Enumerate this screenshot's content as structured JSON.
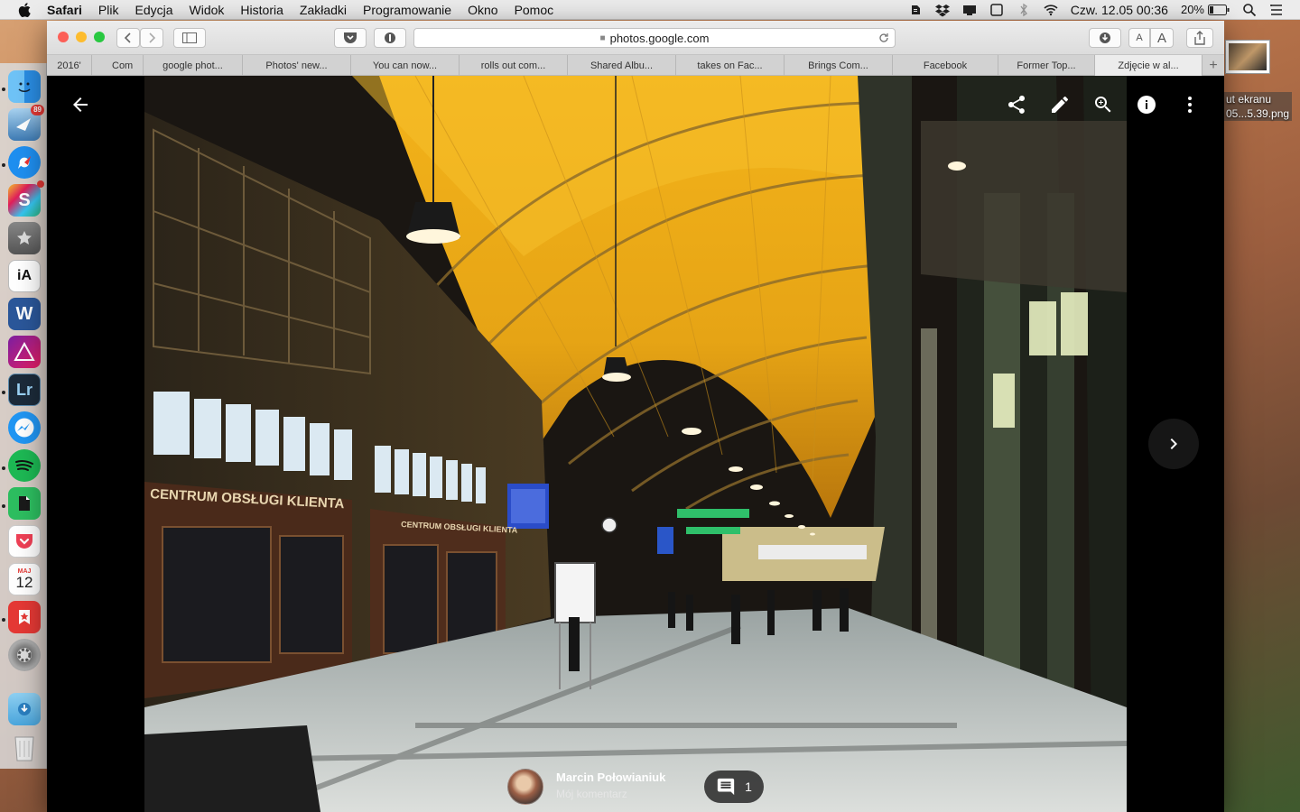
{
  "menubar": {
    "app_name": "Safari",
    "menus": [
      "Plik",
      "Edycja",
      "Widok",
      "Historia",
      "Zakładki",
      "Programowanie",
      "Okno",
      "Pomoc"
    ],
    "clock": "Czw. 12.05  00:36",
    "battery": "20%"
  },
  "browser": {
    "url": "photos.google.com",
    "tabs": [
      {
        "label": "2016'",
        "active": false
      },
      {
        "label": "Com",
        "active": false
      },
      {
        "label": "google phot...",
        "active": false
      },
      {
        "label": "Photos' new...",
        "active": false
      },
      {
        "label": "You can now...",
        "active": false
      },
      {
        "label": "rolls out com...",
        "active": false
      },
      {
        "label": "Shared Albu...",
        "active": false
      },
      {
        "label": "takes on Fac...",
        "active": false
      },
      {
        "label": "Brings Com...",
        "active": false
      },
      {
        "label": "Facebook",
        "active": false
      },
      {
        "label": "Former Top...",
        "active": false
      },
      {
        "label": "Zdjęcie w al...",
        "active": true
      }
    ],
    "text_size_small": "A",
    "text_size_large": "A"
  },
  "viewer": {
    "author": "Marcin Połowianiuk",
    "comment": "Mój komentarz",
    "comment_count": "1",
    "signage_left": "CENTRUM OBSŁUGI KLIENTA",
    "signage_mid": "CENTRUM OBSŁUGI KLIENTA"
  },
  "dock": {
    "badge_mail": "89",
    "calendar_month": "MAJ",
    "calendar_day": "12",
    "word_letter": "W",
    "lr_letters": "Lr",
    "ia_letters": "iA",
    "s_letter": "S"
  },
  "desktop": {
    "file_name_line1": "ut ekranu",
    "file_name_line2": "05...5.39.png"
  },
  "colors": {
    "accent_yellow": "#f2b312",
    "close": "#fc5f57",
    "minimize": "#fdbc2e",
    "zoom": "#28c840"
  }
}
